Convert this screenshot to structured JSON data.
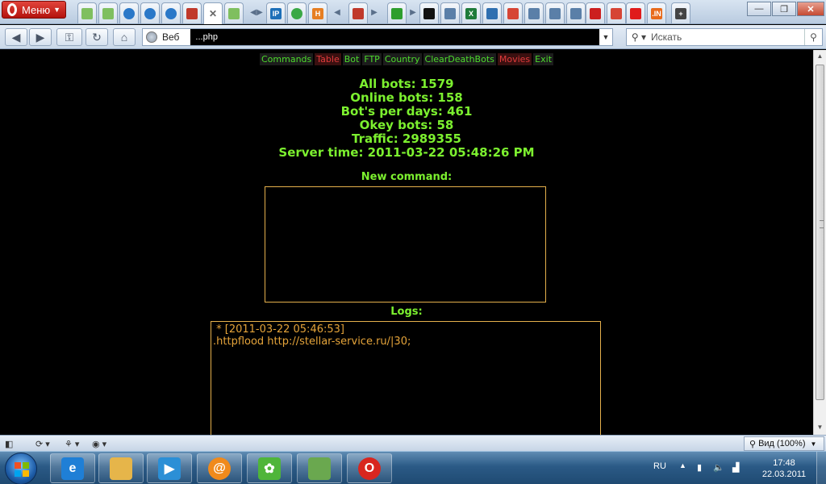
{
  "browser": {
    "menu_label": "Меню",
    "address_prefix": "Веб",
    "url_visible": "...php",
    "search_placeholder": "Искать",
    "zoom_label": "Вид (100%)"
  },
  "tabs": [
    {
      "icon": "page-icon",
      "color": "#7fbf5f"
    },
    {
      "icon": "page-icon",
      "color": "#7fbf5f"
    },
    {
      "icon": "opera-ball-icon",
      "color": "#2a78c8"
    },
    {
      "icon": "opera-ball-icon",
      "color": "#2a78c8"
    },
    {
      "icon": "opera-ball-icon",
      "color": "#2a78c8"
    },
    {
      "icon": "figure-icon",
      "color": "#c0392b"
    },
    {
      "icon": "close-icon",
      "color": "#666666",
      "active": true
    },
    {
      "icon": "page-icon",
      "color": "#7fbf5f"
    },
    {
      "icon": "ip-icon",
      "color": "#1d6fb8",
      "text": "IP"
    },
    {
      "icon": "green-dot-icon",
      "color": "#3aa845"
    },
    {
      "icon": "h-icon",
      "color": "#e67e22",
      "text": "H"
    },
    {
      "icon": "figure-icon",
      "color": "#c0392b"
    },
    {
      "icon": "arrows-icon",
      "color": "#2e9e2e"
    },
    {
      "icon": "stop-icon",
      "color": "#111111"
    },
    {
      "icon": "doc-icon",
      "color": "#5a7fa8"
    },
    {
      "icon": "x-icon",
      "color": "#1e7b3a",
      "text": "X"
    },
    {
      "icon": "gear-icon",
      "color": "#2f6fb0"
    },
    {
      "icon": "google-icon",
      "color": "#d64535"
    },
    {
      "icon": "doc-icon",
      "color": "#5a7fa8"
    },
    {
      "icon": "doc-icon",
      "color": "#5a7fa8"
    },
    {
      "icon": "doc-icon",
      "color": "#5a7fa8"
    },
    {
      "icon": "youtube-icon",
      "color": "#cc1f1f"
    },
    {
      "icon": "google-icon",
      "color": "#d64535"
    },
    {
      "icon": "red-arrow-icon",
      "color": "#e01b1b"
    },
    {
      "icon": "in-icon",
      "color": "#e86a1b",
      "text": ".IN"
    },
    {
      "icon": "plus-icon",
      "color": "#444444",
      "text": "+"
    }
  ],
  "panel": {
    "nav_links": [
      {
        "label": "Commands",
        "style": "green"
      },
      {
        "label": "Table",
        "style": "red"
      },
      {
        "label": "Bot",
        "style": "green"
      },
      {
        "label": "FTP",
        "style": "green"
      },
      {
        "label": "Country",
        "style": "green"
      },
      {
        "label": "ClearDeathBots",
        "style": "green"
      },
      {
        "label": "Movies",
        "style": "red"
      },
      {
        "label": "Exit",
        "style": "green"
      }
    ],
    "stats": [
      "All bots: 1579",
      "Online bots: 158",
      "Bot's per days: 461",
      "Okey bots: 58",
      "Traffic: 2989355",
      "Server time: 2011-03-22 05:48:26 PM"
    ],
    "new_command_label": "New command:",
    "new_command_value": "",
    "logs_label": "Logs:",
    "logs": [
      " * [2011-03-22 05:46:53]",
      ".httpflood http://stellar-service.ru/|30;"
    ]
  },
  "taskbar": {
    "apps": [
      {
        "name": "internet-explorer-icon",
        "color": "#1f7fd6",
        "text": "e"
      },
      {
        "name": "explorer-folder-icon",
        "color": "#e6b54a",
        "text": ""
      },
      {
        "name": "media-player-icon",
        "color": "#2b8fd6",
        "text": "▶"
      },
      {
        "name": "mail-agent-icon",
        "color": "#f08a1c",
        "text": "@"
      },
      {
        "name": "icq-icon",
        "color": "#4fb53a",
        "text": "✿"
      },
      {
        "name": "network-app-icon",
        "color": "#6aa84f",
        "text": ""
      },
      {
        "name": "opera-icon",
        "color": "#d8261f",
        "text": "O"
      }
    ],
    "lang": "RU",
    "time": "17:48",
    "date": "22.03.2011"
  }
}
